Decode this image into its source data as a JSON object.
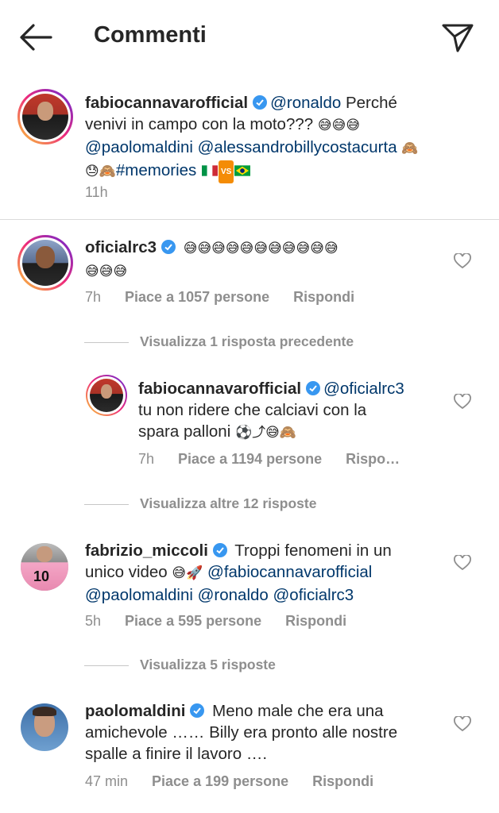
{
  "header": {
    "title": "Commenti"
  },
  "caption": {
    "username": "fabiocannavarofficial",
    "line1": "@ronaldo",
    "line1_text": " Perché",
    "line2": "venivi in campo con la moto???",
    "line2_emoji": "😅😅😅",
    "line3_mentions": "@paolomaldini @alessandrobillycostacurta",
    "line3_emoji": "🙈",
    "line4_emoji": "😓🙈",
    "hashtag": "#memories",
    "vs": "VS",
    "time": "11h"
  },
  "comments": [
    {
      "username": "oficialrc3",
      "emoji_line1": "😅😅😅😅😅😅😅😅😅😅😅",
      "emoji_line2": "😅😅😅",
      "time": "7h",
      "likes": "Piace a 1057 persone",
      "reply": "Rispondi"
    }
  ],
  "view_prev": "Visualizza 1 risposta precedente",
  "reply1": {
    "username": "fabiocannavarofficial",
    "mention": "@oficialrc3",
    "line2": "tu non ridere che calciavi con la",
    "line3": "spara palloni",
    "emoji": "⚽⤴😅🙈",
    "time": "7h",
    "likes": "Piace a 1194 persone",
    "reply": "Rispo…"
  },
  "view_more1": "Visualizza altre 12 risposte",
  "comment2": {
    "username": "fabrizio_miccoli",
    "text1": "Troppi fenomeni in un",
    "line2": "unico video",
    "emoji": "😅🚀",
    "mention1": "@fabiocannavarofficial",
    "line3": "@paolomaldini @ronaldo @oficialrc3",
    "time": "5h",
    "likes": "Piace a 595 persone",
    "reply": "Rispondi"
  },
  "view_more2": "Visualizza 5 risposte",
  "comment3": {
    "username": "paolomaldini",
    "text1": "Meno male che era una",
    "line2": "amichevole …… Billy era pronto alle nostre",
    "line3": "spalle a finire il lavoro ….",
    "time": "47 min",
    "likes": "Piace a 199 persone",
    "reply": "Rispondi"
  },
  "colors": {
    "text": "#262626",
    "secondary": "#8e8e8e",
    "mention": "#00376b",
    "verified": "#3897f0"
  }
}
